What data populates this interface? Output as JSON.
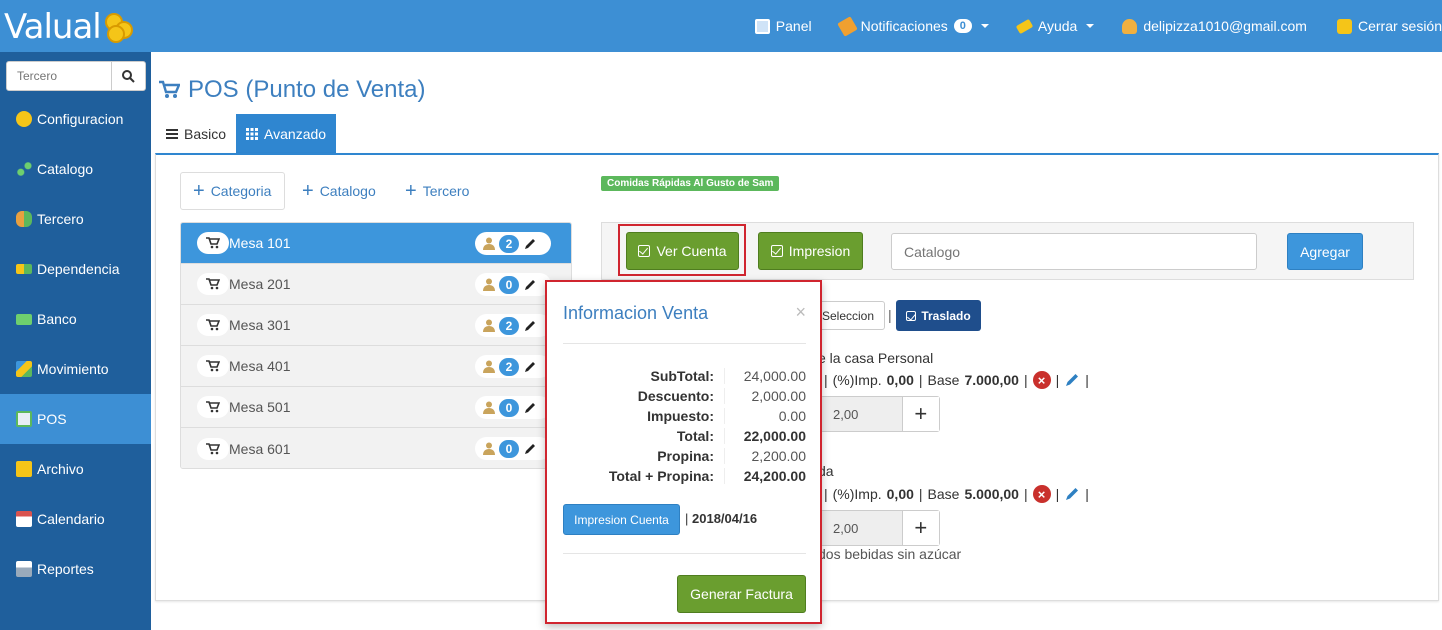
{
  "app": {
    "logo_text": "Valual"
  },
  "topnav": {
    "panel": "Panel",
    "notifications": "Notificaciones",
    "notifications_count": "0",
    "help": "Ayuda",
    "user": "delipizza1010@gmail.com",
    "logout": "Cerrar sesión"
  },
  "sidebar": {
    "search_placeholder": "Tercero",
    "items": [
      {
        "label": "Configuracion",
        "icon": "gear-icon"
      },
      {
        "label": "Catalogo",
        "icon": "dots-icon"
      },
      {
        "label": "Tercero",
        "icon": "people-icon"
      },
      {
        "label": "Dependencia",
        "icon": "blocks-icon"
      },
      {
        "label": "Banco",
        "icon": "money-icon"
      },
      {
        "label": "Movimiento",
        "icon": "boxes-icon"
      },
      {
        "label": "POS",
        "icon": "cart-add-icon"
      },
      {
        "label": "Archivo",
        "icon": "folder-icon"
      },
      {
        "label": "Calendario",
        "icon": "calendar-icon"
      },
      {
        "label": "Reportes",
        "icon": "printer-icon"
      }
    ],
    "active_index": 6
  },
  "page": {
    "title": "POS (Punto de Venta)",
    "tabs": [
      {
        "label": "Basico"
      },
      {
        "label": "Avanzado"
      }
    ]
  },
  "actions": {
    "categoria": "Categoria",
    "catalogo": "Catalogo",
    "tercero": "Tercero"
  },
  "mesas": [
    {
      "name": "Mesa 101",
      "count": "2"
    },
    {
      "name": "Mesa 201",
      "count": "0"
    },
    {
      "name": "Mesa 301",
      "count": "2"
    },
    {
      "name": "Mesa 401",
      "count": "2"
    },
    {
      "name": "Mesa 501",
      "count": "0"
    },
    {
      "name": "Mesa 601",
      "count": "0"
    }
  ],
  "restaurant": {
    "name": "Comidas Rápidas Al Gusto de Sam"
  },
  "toolbar": {
    "ver_cuenta": "Ver Cuenta",
    "impresion": "Impresion",
    "catalog_placeholder": "Catalogo",
    "agregar": "Agregar"
  },
  "order": {
    "seleccion": "Seleccion",
    "traslado": "Traslado",
    "item1_name_fragment": "e la casa Personal",
    "item1_imp_label": "(%)Imp.",
    "item1_imp": "0,00",
    "item1_base_label": "Base",
    "item1_base": "7.000,00",
    "item1_qty": "2,00",
    "item2_name_fragment": "da",
    "item2_imp_label": "(%)Imp.",
    "item2_imp": "0,00",
    "item2_base_label": "Base",
    "item2_base": "5.000,00",
    "item2_qty": "2,00",
    "item2_note_fragment": "dos bebidas sin azúcar"
  },
  "modal": {
    "title": "Informacion Venta",
    "close": "×",
    "rows": [
      {
        "label": "SubTotal:",
        "value": "24,000.00"
      },
      {
        "label": "Descuento:",
        "value": "2,000.00"
      },
      {
        "label": "Impuesto:",
        "value": "0.00"
      },
      {
        "label": "Total:",
        "value": "22,000.00"
      },
      {
        "label": "Propina:",
        "value": "2,200.00"
      },
      {
        "label": "Total + Propina:",
        "value": "24,200.00"
      }
    ],
    "print_button": "Impresion Cuenta",
    "separator": "|",
    "date": "2018/04/16",
    "generate_button": "Generar Factura"
  }
}
